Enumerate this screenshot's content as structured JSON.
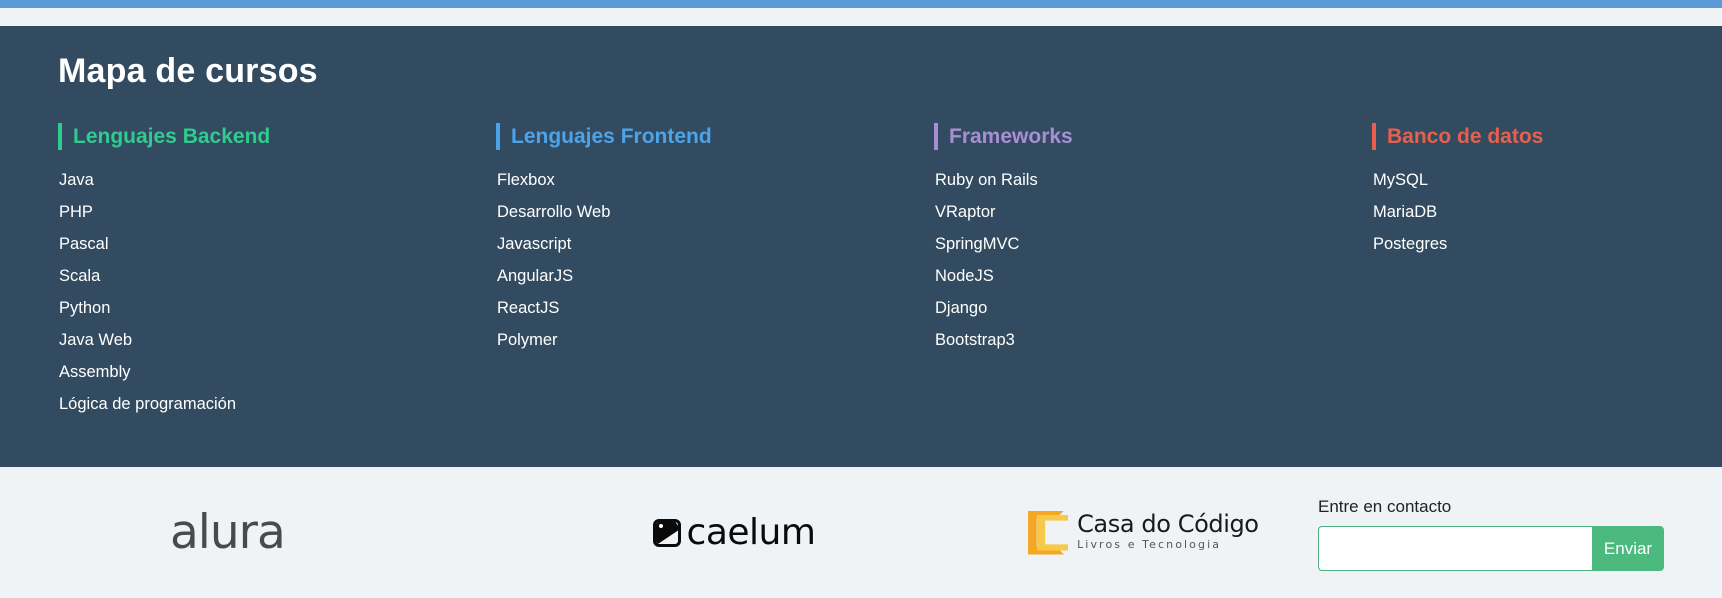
{
  "theme": {
    "top_bar_color": "#5b9bd5",
    "page_bg": "#eff3f6",
    "map_bg": "#334b60",
    "text_on_dark": "#ffffff",
    "accent_green": "#2ecc8f",
    "accent_blue": "#4da3e8",
    "accent_purple": "#a88fd4",
    "accent_red": "#e8604c",
    "submit_green": "#4cb97e"
  },
  "map": {
    "title": "Mapa de cursos",
    "columns": [
      {
        "title": "Lenguajes Backend",
        "color": "#2ecc8f",
        "accent_color": "#2ecc8f",
        "items": [
          "Java",
          "PHP",
          "Pascal",
          "Scala",
          "Python",
          "Java Web",
          "Assembly",
          "Lógica de programación"
        ]
      },
      {
        "title": "Lenguajes Frontend",
        "color": "#4da3e8",
        "accent_color": "#4da3e8",
        "items": [
          "Flexbox",
          "Desarrollo Web",
          "Javascript",
          "AngularJS",
          "ReactJS",
          "Polymer"
        ]
      },
      {
        "title": "Frameworks",
        "color": "#a88fd4",
        "accent_color": "#a88fd4",
        "items": [
          "Ruby on Rails",
          "VRaptor",
          "SpringMVC",
          "NodeJS",
          "Django",
          "Bootstrap3"
        ]
      },
      {
        "title": "Banco de datos",
        "color": "#e8604c",
        "accent_color": "#e8604c",
        "items": [
          "MySQL",
          "MariaDB",
          "Postegres"
        ]
      }
    ]
  },
  "footer": {
    "logos": [
      {
        "name": "alura-logo",
        "text": "alura"
      },
      {
        "name": "caelum-logo",
        "text": "caelum"
      },
      {
        "name": "casa-do-codigo-logo",
        "title": "Casa do Código",
        "subtitle": "Livros e Tecnologia"
      }
    ],
    "contact": {
      "label": "Entre en contacto",
      "input_value": "",
      "input_placeholder": "",
      "submit_label": "Enviar"
    }
  }
}
